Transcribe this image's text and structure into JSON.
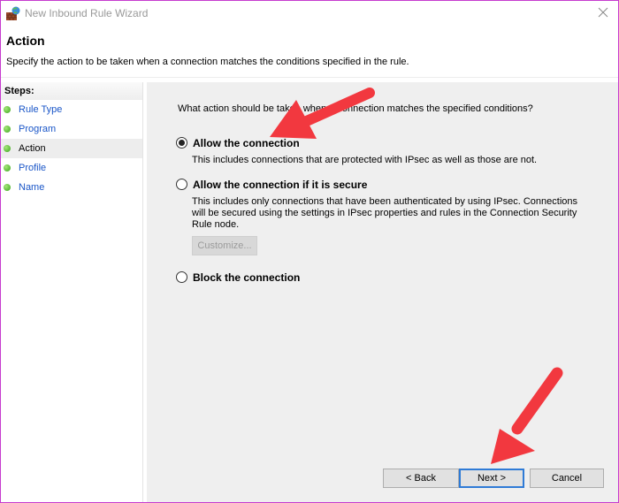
{
  "window": {
    "title": "New Inbound Rule Wizard",
    "icons": {
      "app": "firewall-icon",
      "close": "close-icon"
    }
  },
  "header": {
    "title": "Action",
    "description": "Specify the action to be taken when a connection matches the conditions specified in the rule."
  },
  "sidebar": {
    "heading": "Steps:",
    "items": [
      {
        "label": "Rule Type",
        "active": false
      },
      {
        "label": "Program",
        "active": false
      },
      {
        "label": "Action",
        "active": true
      },
      {
        "label": "Profile",
        "active": false
      },
      {
        "label": "Name",
        "active": false
      }
    ]
  },
  "main": {
    "question": "What action should be taken when a connection matches the specified conditions?",
    "options": [
      {
        "label": "Allow the connection",
        "checked": true,
        "description": "This includes connections that are protected with IPsec as well as those are not."
      },
      {
        "label": "Allow the connection if it is secure",
        "checked": false,
        "description": "This includes only connections that have been authenticated by using IPsec.  Connections will be secured using the settings in IPsec properties and rules in the Connection Security Rule node."
      },
      {
        "label": "Block the connection",
        "checked": false,
        "description": ""
      }
    ],
    "customize_label": "Customize..."
  },
  "buttons": {
    "back": "< Back",
    "next": "Next >",
    "cancel": "Cancel"
  },
  "annotations": {
    "arrow_color": "#f2383f"
  }
}
